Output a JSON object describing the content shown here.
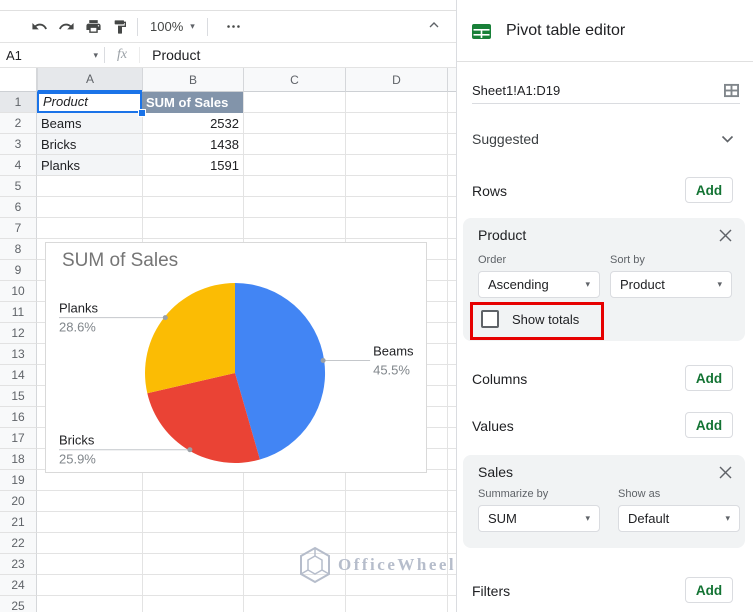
{
  "toolbar": {
    "zoom_value": "100%"
  },
  "formula_bar": {
    "cell_ref": "A1",
    "fx_label": "fx",
    "value": "Product"
  },
  "sheet": {
    "columns": [
      "A",
      "B",
      "C",
      "D"
    ],
    "row_count": 25,
    "cells": [
      {
        "col": "A",
        "row": 1,
        "text": "Product",
        "kind": "selected-header"
      },
      {
        "col": "B",
        "row": 1,
        "text": "SUM of Sales",
        "kind": "pivot-header"
      },
      {
        "col": "A",
        "row": 2,
        "text": "Beams",
        "kind": "row-label"
      },
      {
        "col": "B",
        "row": 2,
        "text": "2532",
        "kind": "number"
      },
      {
        "col": "A",
        "row": 3,
        "text": "Bricks",
        "kind": "row-label"
      },
      {
        "col": "B",
        "row": 3,
        "text": "1438",
        "kind": "number"
      },
      {
        "col": "A",
        "row": 4,
        "text": "Planks",
        "kind": "row-label"
      },
      {
        "col": "B",
        "row": 4,
        "text": "1591",
        "kind": "number"
      }
    ]
  },
  "chart_data": {
    "type": "pie",
    "title": "SUM of Sales",
    "categories": [
      "Beams",
      "Bricks",
      "Planks"
    ],
    "values": [
      2532,
      1438,
      1591
    ],
    "percent_labels": [
      "45.5%",
      "25.9%",
      "28.6%"
    ],
    "colors": [
      "#4285f4",
      "#ea4335",
      "#fbbc04"
    ],
    "start_angle_deg": 0,
    "legend_position": "outside-labels-with-leader-lines"
  },
  "watermark": {
    "text": "OfficeWheel"
  },
  "panel": {
    "title": "Pivot table editor",
    "range": "Sheet1!A1:D19",
    "suggested_label": "Suggested",
    "rows": {
      "label": "Rows",
      "add": "Add"
    },
    "columns": {
      "label": "Columns",
      "add": "Add"
    },
    "values": {
      "label": "Values",
      "add": "Add"
    },
    "filters": {
      "label": "Filters",
      "add": "Add"
    },
    "product_card": {
      "title": "Product",
      "order_label": "Order",
      "order_value": "Ascending",
      "sortby_label": "Sort by",
      "sortby_value": "Product",
      "show_totals_label": "Show totals",
      "show_totals_checked": false
    },
    "sales_card": {
      "title": "Sales",
      "summarize_label": "Summarize by",
      "summarize_value": "SUM",
      "showas_label": "Show as",
      "showas_value": "Default"
    }
  },
  "colors": {
    "selection_accent": "#1a73e8",
    "pivot_header_bg": "#8294aa",
    "add_button_green": "#137333",
    "panel_icon_green": "#188038",
    "annotation_red": "#e60000"
  }
}
